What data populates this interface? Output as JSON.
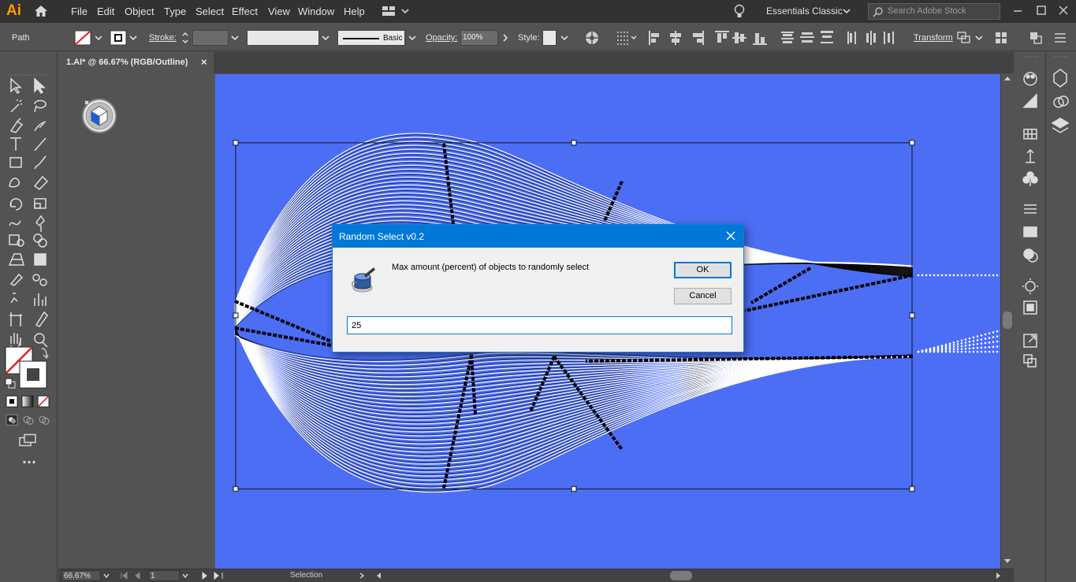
{
  "app": {
    "logo": "Ai"
  },
  "menu": [
    "File",
    "Edit",
    "Object",
    "Type",
    "Select",
    "Effect",
    "View",
    "Window",
    "Help"
  ],
  "workspace": {
    "label": "Essentials Classic"
  },
  "search": {
    "placeholder": "Search Adobe Stock"
  },
  "control_bar": {
    "selection_type": "Path",
    "stroke_label": "Stroke:",
    "brush_label": "Basic",
    "opacity_label": "Opacity:",
    "opacity_value": "100%",
    "style_label": "Style:",
    "transform_label": "Transform"
  },
  "document_tab": {
    "title": "1.AI* @ 66.67% (RGB/Outline)",
    "close": "×"
  },
  "status_bar": {
    "zoom": "66.67%",
    "artboard": "1",
    "tool": "Selection"
  },
  "dialog": {
    "title": "Random Select v0.2",
    "message": "Max amount (percent) of objects to randomly select",
    "ok_label": "OK",
    "cancel_label": "Cancel",
    "input_value": "25"
  },
  "colors": {
    "artboard": "#4c6ef5",
    "titlebar": "#0078d7",
    "chrome_dark": "#323232",
    "chrome": "#535353"
  }
}
